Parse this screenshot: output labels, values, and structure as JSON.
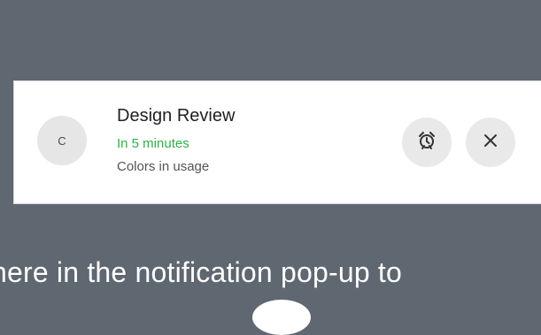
{
  "notification": {
    "avatar_initial": "C",
    "title": "Design Review",
    "time": "In 5 minutes",
    "subtitle": "Colors in usage"
  },
  "icons": {
    "snooze": "alarm-clock-icon",
    "close": "close-icon"
  },
  "caption": "here in the notification pop-up to",
  "colors": {
    "background": "#5f6770",
    "time_green": "#2fb04a"
  }
}
